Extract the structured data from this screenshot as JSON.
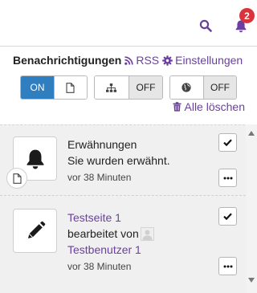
{
  "topbar": {
    "notification_count": "2",
    "icons": [
      "search-icon",
      "bell-icon"
    ],
    "accent": "#6b3fa0",
    "badge_color": "#d9343b"
  },
  "header": {
    "title": "Benachrichtigungen",
    "rss_label": "RSS",
    "settings_label": "Einstellungen"
  },
  "toggles": {
    "group1": {
      "on_label": "ON",
      "icon": "file-icon"
    },
    "group2": {
      "icon": "sitemap-icon",
      "off_label": "OFF"
    },
    "group3": {
      "icon": "globe-icon",
      "off_label": "OFF"
    }
  },
  "actions": {
    "delete_all_label": "Alle löschen"
  },
  "notifications": [
    {
      "icon": "bell-icon",
      "sub_icon": "file-icon",
      "title": "Erwähnungen",
      "message": "Sie wurden erwähnt.",
      "time": "vor 38 Minuten"
    },
    {
      "icon": "pencil-icon",
      "page_link": "Testseite 1",
      "edited_by": "bearbeitet von",
      "user_link": "Testbenutzer 1",
      "time": "vor 38 Minuten"
    }
  ]
}
